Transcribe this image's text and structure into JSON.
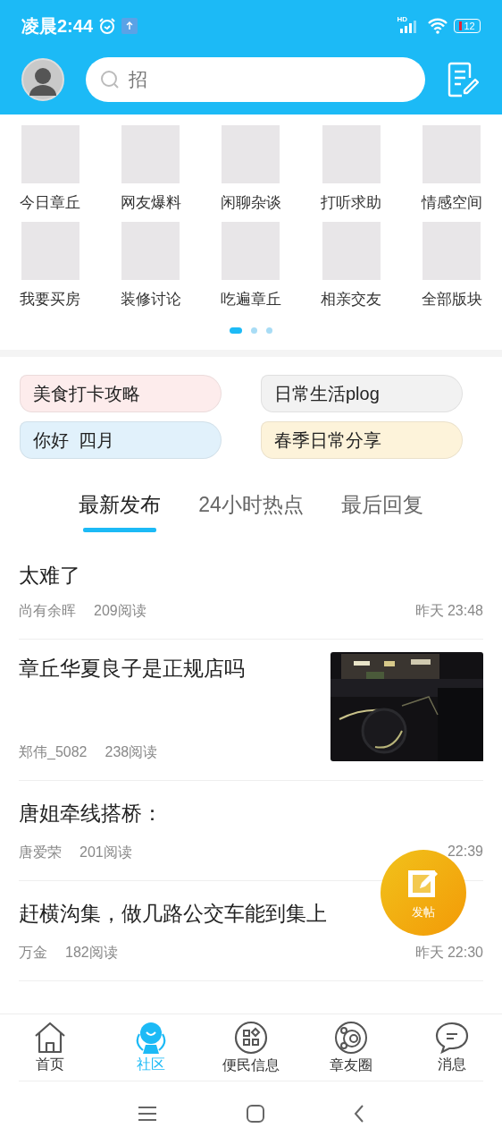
{
  "status_bar": {
    "time": "凌晨2:44",
    "network_label": "HD",
    "battery": "12"
  },
  "header": {
    "search": {
      "placeholder": "招"
    }
  },
  "categories": [
    {
      "label": "今日章丘"
    },
    {
      "label": "网友爆料"
    },
    {
      "label": "闲聊杂谈"
    },
    {
      "label": "打听求助"
    },
    {
      "label": "情感空间"
    },
    {
      "label": "我要买房"
    },
    {
      "label": "装修讨论"
    },
    {
      "label": "吃遍章丘"
    },
    {
      "label": "相亲交友"
    },
    {
      "label": "全部版块"
    }
  ],
  "pager": [
    {
      "selected": true
    },
    {
      "selected": false
    },
    {
      "selected": false
    }
  ],
  "topics": [
    {
      "label": "美食打卡攻略",
      "color": "#fdecec"
    },
    {
      "label": "日常生活plog",
      "color": "#f2f2f2"
    },
    {
      "label": "你好  四月",
      "color": "#e1f1fb"
    },
    {
      "label": "春季日常分享",
      "color": "#fdf3da"
    }
  ],
  "feed_tabs": [
    {
      "label": "最新发布",
      "selected": true
    },
    {
      "label": "24小时热点",
      "selected": false
    },
    {
      "label": "最后回复",
      "selected": false
    }
  ],
  "posts": [
    {
      "kind": "text",
      "title": "太难了",
      "author": "尚有余晖",
      "reads": "209阅读",
      "time": "昨天 23:48"
    },
    {
      "kind": "picture",
      "title": "章丘华夏良子是正规店吗",
      "author": "郑伟_5082",
      "reads": "238阅读"
    },
    {
      "kind": "text",
      "title": "唐姐牵线搭桥：",
      "author": "唐爱荣",
      "reads": "201阅读",
      "time": "22:39"
    },
    {
      "kind": "text",
      "title": "赶横沟集，做几路公交车能到集上",
      "author": "万金",
      "reads": "182阅读",
      "time": "昨天 22:30"
    }
  ],
  "fab": {
    "label": "发帖"
  },
  "bottom_nav": [
    {
      "label": "首页",
      "selected": false
    },
    {
      "label": "社区",
      "selected": true
    },
    {
      "label": "便民信息",
      "selected": false
    },
    {
      "label": "章友圈",
      "selected": false
    },
    {
      "label": "消息",
      "selected": false
    }
  ]
}
